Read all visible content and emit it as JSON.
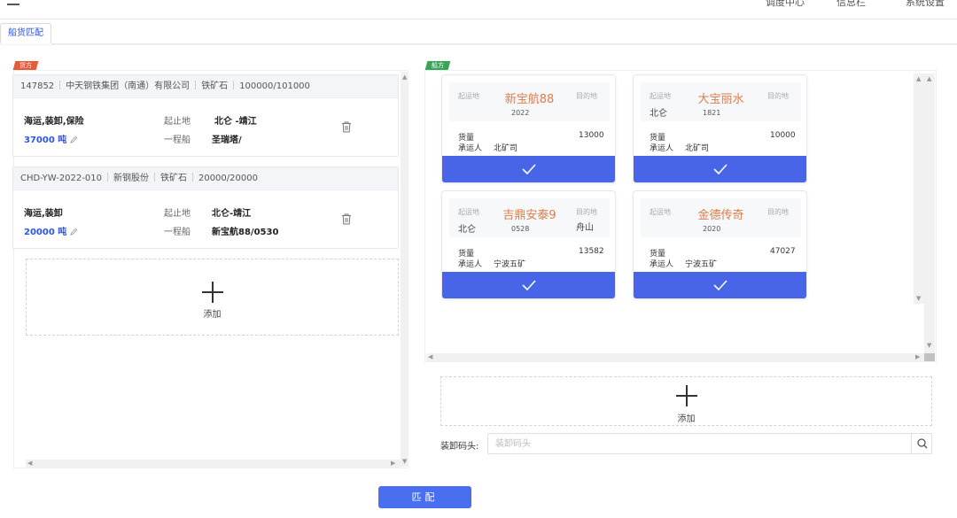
{
  "header": {
    "right_items": [
      "调度中心",
      "信息栏",
      "系统设置"
    ]
  },
  "tabs": [
    {
      "label": "船货匹配"
    }
  ],
  "left": {
    "ribbon": "货方",
    "cargos": [
      {
        "code": "147852",
        "company": "中天钢铁集团（南通）有限公司",
        "goods": "铁矿石",
        "amount": "100000/101000",
        "terms": "海运,装卸,保险",
        "tonnage": "37000 吨",
        "route_label": "起止地",
        "route": "北仑 -靖江",
        "ship_label": "一程船",
        "ship": "圣瑞塔/"
      },
      {
        "code": "CHD-YW-2022-010",
        "company": "新钢股份",
        "goods": "铁矿石",
        "amount": "20000/20000",
        "terms": "海运,装卸",
        "tonnage": "20000 吨",
        "route_label": "起止地",
        "route": "北仑-靖江",
        "ship_label": "一程船",
        "ship": "新宝航88/0530"
      }
    ],
    "add_label": "添加"
  },
  "right": {
    "ribbon": "船方",
    "labels": {
      "origin": "起运地",
      "destination": "目的地",
      "cargo": "货量",
      "carrier": "承运人"
    },
    "ships": [
      {
        "name": "新宝航88",
        "year": "2022",
        "origin_port": "",
        "dest_port": "",
        "cargo_qty": "13000",
        "carrier": "北矿司"
      },
      {
        "name": "大宝丽水",
        "year": "1821",
        "origin_port": "北仑",
        "dest_port": "",
        "cargo_qty": "10000",
        "carrier": "北矿司"
      },
      {
        "name": "吉鼎安泰9",
        "year": "0528",
        "origin_port": "北仑",
        "dest_port": "舟山",
        "cargo_qty": "13582",
        "carrier": "宁波五矿"
      },
      {
        "name": "金德传奇",
        "year": "2020",
        "origin_port": "",
        "dest_port": "",
        "cargo_qty": "47027",
        "carrier": "宁波五矿"
      }
    ],
    "add_label": "添加",
    "dock_label": "装卸码头:",
    "dock_placeholder": "装卸码头"
  },
  "actions": {
    "match": "匹配"
  },
  "colors": {
    "accent": "#4865e8",
    "ship_name": "#e07b4a",
    "ribbon_red": "#e55b3c",
    "ribbon_green": "#3aa55a"
  }
}
